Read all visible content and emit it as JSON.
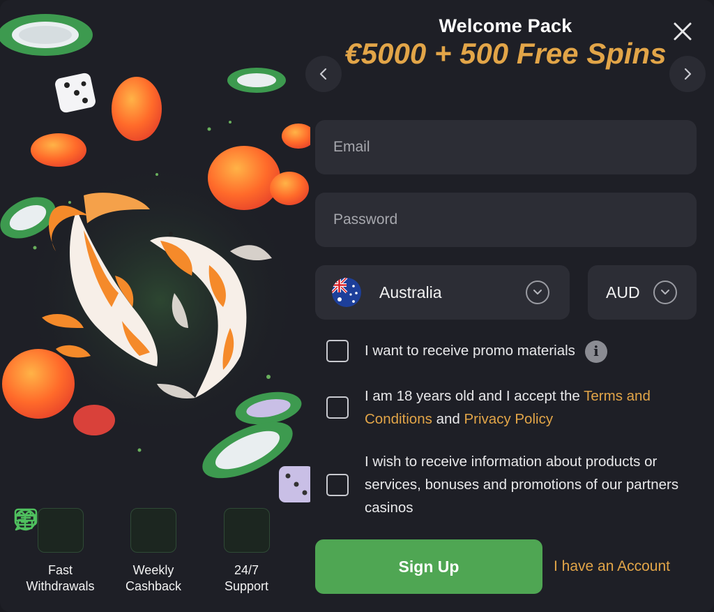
{
  "header": {
    "title": "Welcome Pack",
    "promo": "€5000 + 500 Free Spins"
  },
  "form": {
    "email_placeholder": "Email",
    "password_placeholder": "Password",
    "country": "Australia",
    "currency": "AUD"
  },
  "checks": {
    "promo_materials": "I want to receive promo materials",
    "age_prefix": "I am 18 years old and I accept the ",
    "terms_link": "Terms and Conditions",
    "and_text": " and ",
    "privacy_link": "Privacy Policy",
    "partners": "I wish to receive information about products or services, bonuses and promotions of our partners casinos"
  },
  "actions": {
    "signup": "Sign Up",
    "have_account": "I have an Account"
  },
  "features": [
    {
      "label": "Fast\nWithdrawals",
      "icon": "card-icon"
    },
    {
      "label": "Weekly\nCashback",
      "icon": "gift-icon"
    },
    {
      "label": "24/7\nSupport",
      "icon": "chat-icon"
    }
  ],
  "colors": {
    "accent_gold": "#e2a548",
    "signup_green": "#4fa653",
    "background": "#1e1f26",
    "field_bg": "#2c2d35"
  }
}
